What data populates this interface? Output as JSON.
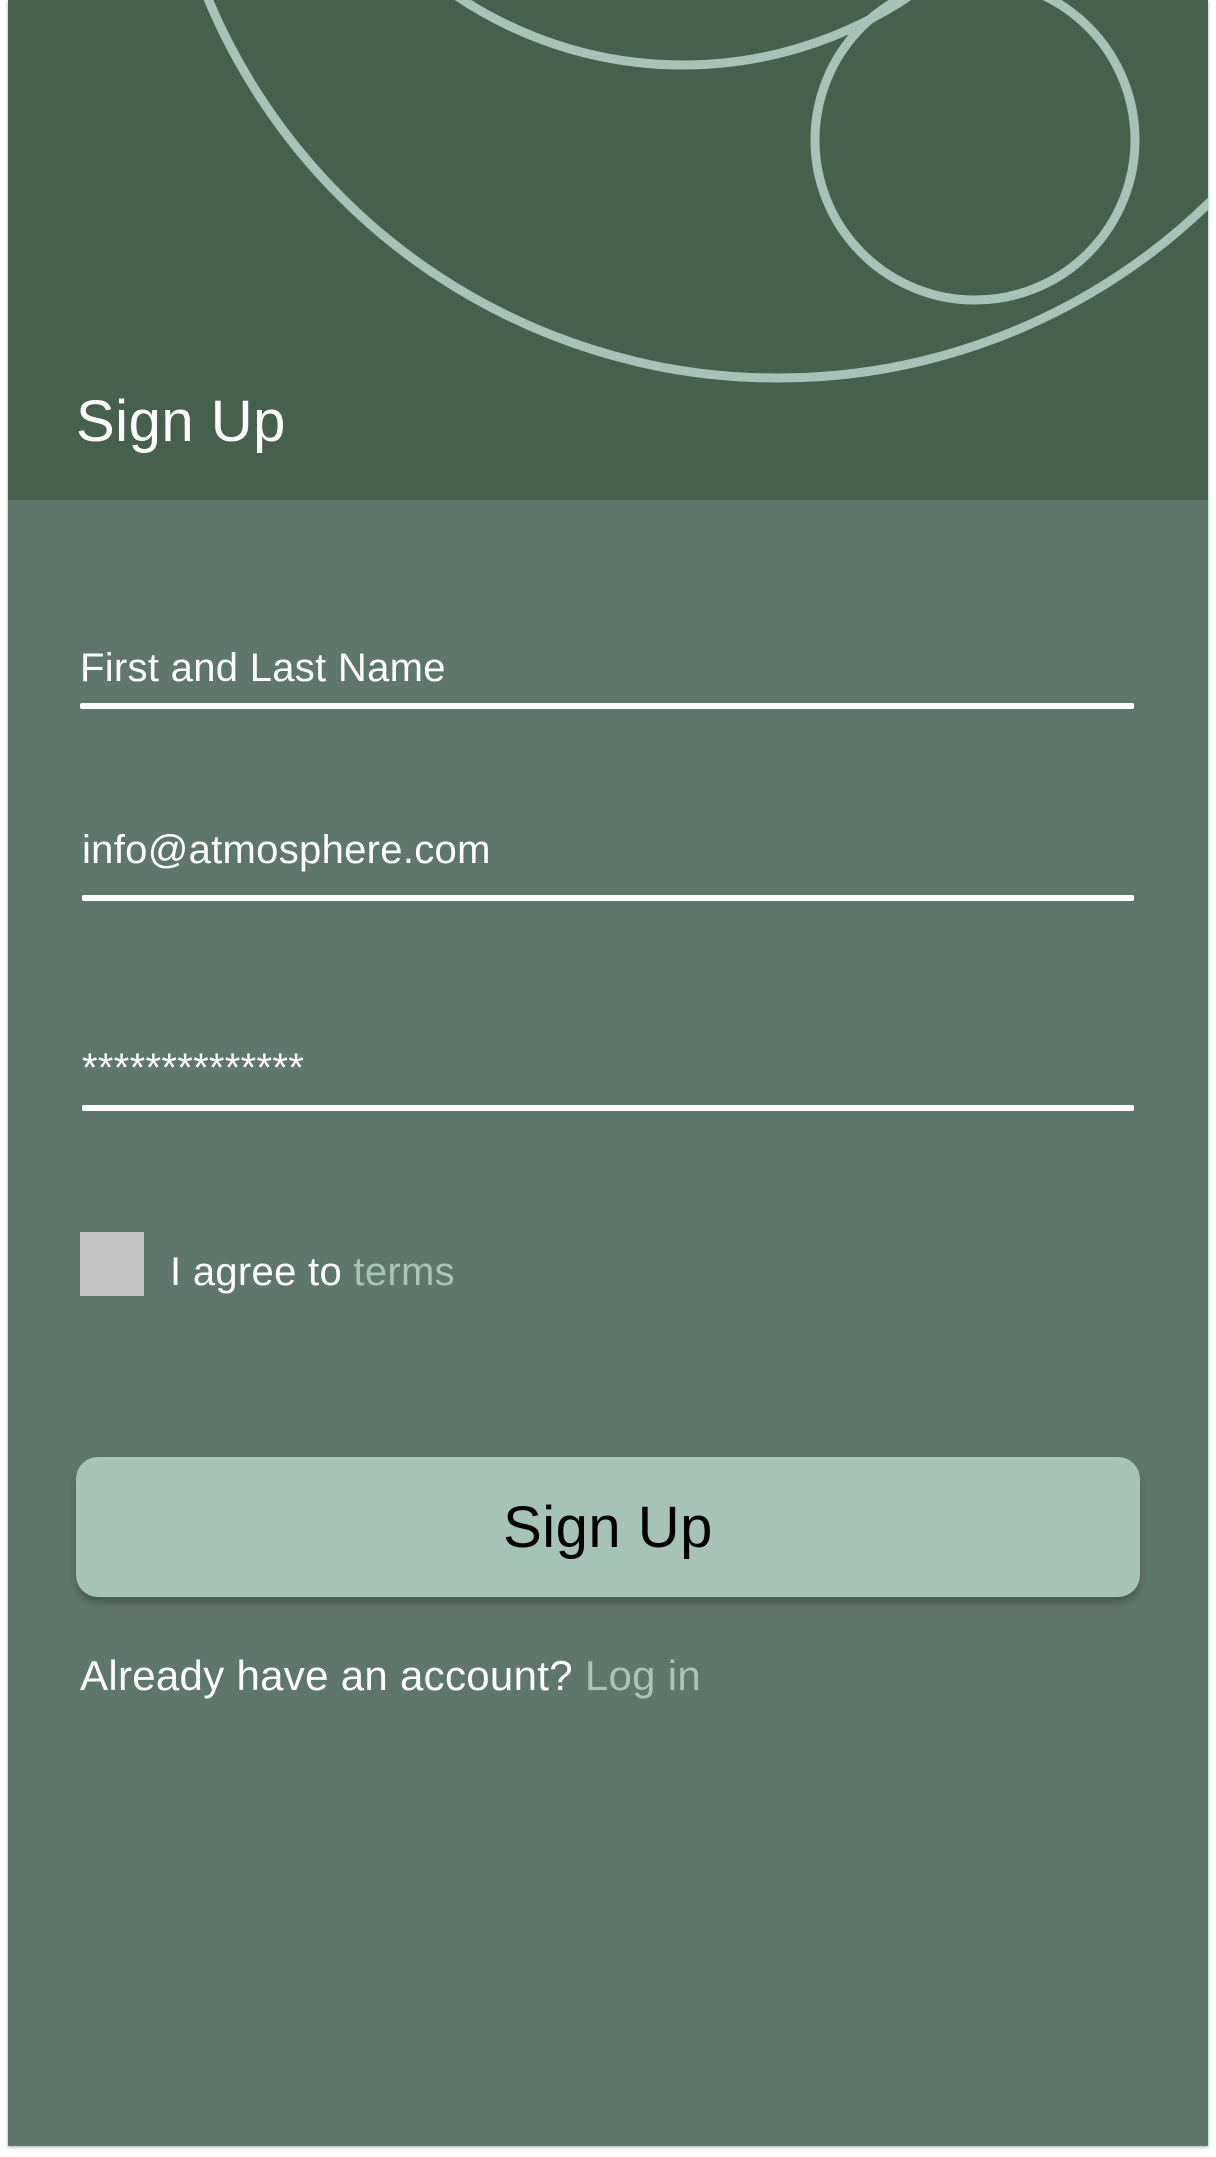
{
  "header": {
    "title": "Sign Up"
  },
  "form": {
    "name_value": "First and Last Name",
    "email_value": "info@atmosphere.com",
    "password_value": "**************",
    "agree_prefix": "I agree to ",
    "agree_link": "terms",
    "agree_checked": false,
    "submit_label": "Sign Up"
  },
  "footer": {
    "login_prompt": "Already have an account? ",
    "login_link": "Log in"
  },
  "colors": {
    "header_bg": "#45614e",
    "body_bg": "#5e776c",
    "accent": "#a6c3b8",
    "checkbox": "#c4c4c4"
  }
}
